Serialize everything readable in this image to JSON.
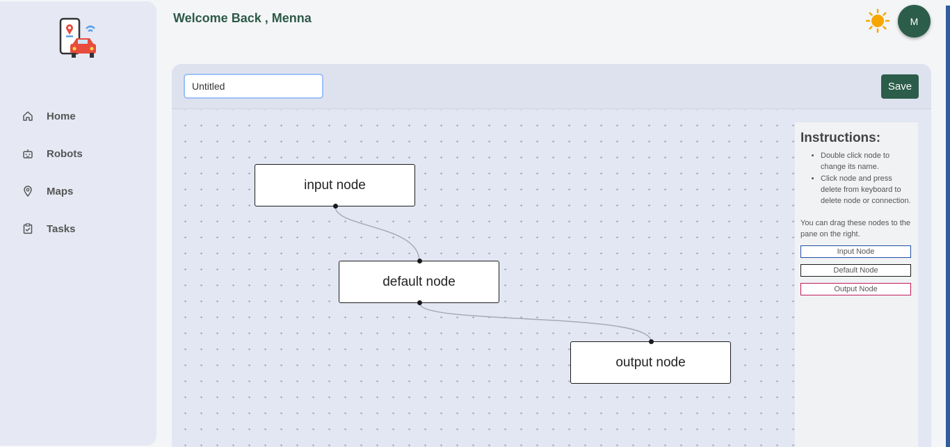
{
  "header": {
    "welcome": "Welcome Back , Menna",
    "avatar_initial": "M"
  },
  "sidebar": {
    "items": [
      {
        "label": "Home",
        "icon": "home-icon"
      },
      {
        "label": "Robots",
        "icon": "robot-icon"
      },
      {
        "label": "Maps",
        "icon": "map-pin-icon"
      },
      {
        "label": "Tasks",
        "icon": "clipboard-check-icon"
      }
    ]
  },
  "editor": {
    "title_value": "Untitled",
    "save_label": "Save"
  },
  "flow": {
    "nodes": [
      {
        "label": "input node",
        "type": "input"
      },
      {
        "label": "default node",
        "type": "default"
      },
      {
        "label": "output node",
        "type": "output"
      }
    ]
  },
  "instructions": {
    "title": "Instructions:",
    "bullets": [
      "Double click node to change its name.",
      "Click node and press delete from keyboard to delete node or connection."
    ],
    "drag_note": "You can drag these nodes to the pane on the right.",
    "palette": [
      {
        "label": "Input Node",
        "color": "#1f4fa3"
      },
      {
        "label": "Default Node",
        "color": "#1a1a1a"
      },
      {
        "label": "Output Node",
        "color": "#c2185b"
      }
    ]
  },
  "colors": {
    "accent": "#2b5d4a",
    "heading": "#2d5a47",
    "sun": "#f7a600"
  }
}
